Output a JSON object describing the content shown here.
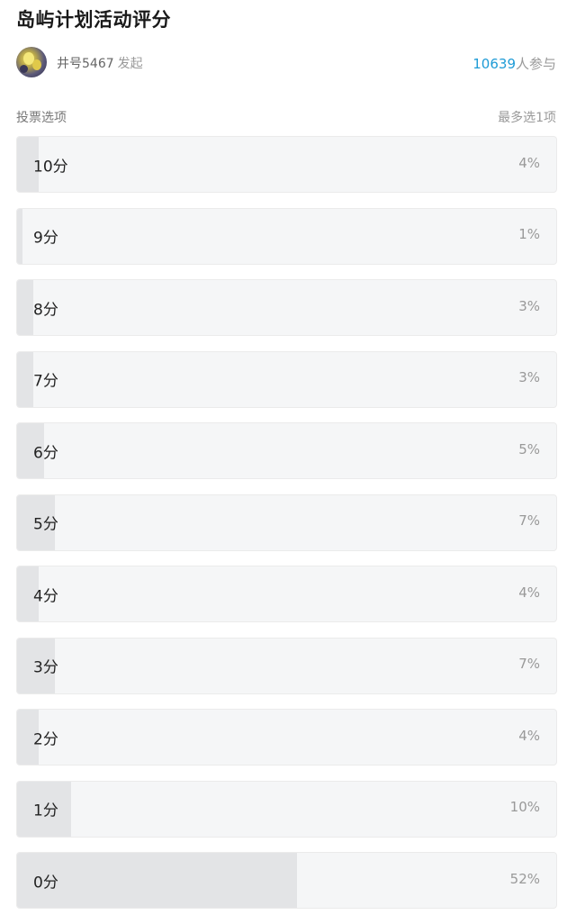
{
  "poll": {
    "title": "岛屿计划活动评分",
    "author": {
      "name": "井号5467",
      "action": "发起",
      "avatar_icon": "user-avatar-image"
    },
    "participants": {
      "count": "10639",
      "suffix": "人参与"
    },
    "options_label": "投票选项",
    "limit_text": "最多选1项",
    "colors": {
      "accent": "#1e9bd6",
      "option_bg": "#f5f6f7",
      "option_fill": "#e3e4e6"
    },
    "options": [
      {
        "label": "10分",
        "percent": "4%",
        "share": 4
      },
      {
        "label": "9分",
        "percent": "1%",
        "share": 1
      },
      {
        "label": "8分",
        "percent": "3%",
        "share": 3
      },
      {
        "label": "7分",
        "percent": "3%",
        "share": 3
      },
      {
        "label": "6分",
        "percent": "5%",
        "share": 5
      },
      {
        "label": "5分",
        "percent": "7%",
        "share": 7
      },
      {
        "label": "4分",
        "percent": "4%",
        "share": 4
      },
      {
        "label": "3分",
        "percent": "7%",
        "share": 7
      },
      {
        "label": "2分",
        "percent": "4%",
        "share": 4
      },
      {
        "label": "1分",
        "percent": "10%",
        "share": 10
      },
      {
        "label": "0分",
        "percent": "52%",
        "share": 52
      }
    ]
  }
}
